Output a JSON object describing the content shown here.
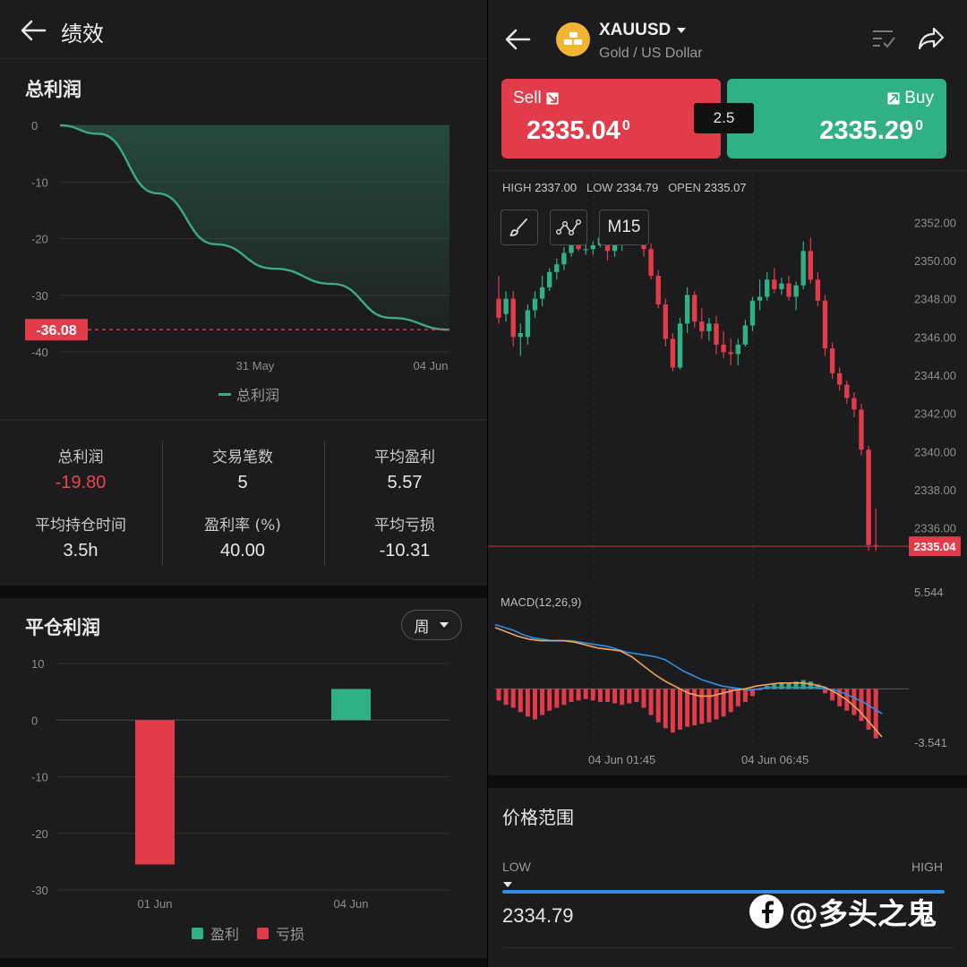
{
  "left": {
    "header": {
      "title": "绩效"
    },
    "total_profit_section": {
      "title": "总利润",
      "current_label": "-36.08",
      "legend": "总利润"
    },
    "stats": [
      {
        "label": "总利润",
        "value": "-19.80",
        "value_color": "#e8454f"
      },
      {
        "label": "交易笔数",
        "value": "5"
      },
      {
        "label": "平均盈利",
        "value": "5.57"
      },
      {
        "label": "平均持仓时间",
        "value": "3.5h"
      },
      {
        "label": "盈利率 (%)",
        "value": "40.00"
      },
      {
        "label": "平均亏损",
        "value": "-10.31"
      }
    ],
    "closed_profit_section": {
      "title": "平仓利润",
      "period_selected": "周",
      "legend_profit": "盈利",
      "legend_loss": "亏损"
    }
  },
  "right": {
    "header": {
      "symbol": "XAUUSD",
      "subtitle": "Gold / US Dollar"
    },
    "sell": {
      "label": "Sell",
      "price_main": "2335.04",
      "price_sup": "0"
    },
    "buy": {
      "label": "Buy",
      "price_main": "2335.29",
      "price_sup": "0"
    },
    "spread": "2.5",
    "ohlc": {
      "high_label": "HIGH",
      "high": "2337.00",
      "low_label": "LOW",
      "low": "2334.79",
      "open_label": "OPEN",
      "open": "2335.07"
    },
    "timeframe": "M15",
    "current_price_label": "2335.04",
    "macd": {
      "label": "MACD(12,26,9)",
      "max": "5.544",
      "min": "-3.541"
    },
    "time_labels": [
      "04 Jun 01:45",
      "04 Jun 06:45"
    ],
    "price_range": {
      "title": "价格范围",
      "low_label": "LOW",
      "high_label": "HIGH",
      "low_value": "2334.79"
    },
    "watermark": "@多头之鬼"
  },
  "colors": {
    "up": "#2fb183",
    "down": "#e23b4a",
    "accent_line": "#3ea983",
    "blue": "#2f8fe6",
    "orange": "#f0a35a"
  },
  "chart_data": [
    {
      "type": "area",
      "title": "总利润",
      "legend": [
        "总利润"
      ],
      "x": [
        "31 May",
        "04 Jun"
      ],
      "yticks": [
        0,
        -10,
        -20,
        -30,
        -40
      ],
      "ylim": [
        -40,
        0
      ],
      "series": [
        {
          "name": "总利润",
          "points": [
            [
              0,
              0
            ],
            [
              0.1,
              -1.5
            ],
            [
              0.25,
              -12
            ],
            [
              0.4,
              -21
            ],
            [
              0.55,
              -25.3
            ],
            [
              0.7,
              -28
            ],
            [
              0.85,
              -34
            ],
            [
              1.0,
              -36.08
            ]
          ]
        }
      ],
      "annotation": {
        "value": -36.08,
        "style": "dashed"
      }
    },
    {
      "type": "bar",
      "title": "平仓利润",
      "categories": [
        "01 Jun",
        "04 Jun"
      ],
      "values": [
        -25.5,
        5.5
      ],
      "yticks": [
        10,
        0,
        -10,
        -20,
        -30
      ],
      "ylim": [
        -30,
        10
      ],
      "legend": [
        "盈利",
        "亏损"
      ]
    },
    {
      "type": "candlestick",
      "title": "XAUUSD M15",
      "yticks": [
        2352,
        2350,
        2348,
        2346,
        2344,
        2342,
        2340,
        2338,
        2336
      ],
      "ylim": [
        2334.2,
        2353
      ],
      "x": [
        "04 Jun 01:45",
        "04 Jun 06:45"
      ],
      "candles": [
        [
          2348.0,
          2349.2,
          2346.7,
          2347.0
        ],
        [
          2347.2,
          2348.4,
          2346.8,
          2348.0
        ],
        [
          2348.0,
          2348.4,
          2345.5,
          2346.0
        ],
        [
          2346.0,
          2346.7,
          2345.0,
          2346.2
        ],
        [
          2346.0,
          2347.7,
          2345.6,
          2347.4
        ],
        [
          2347.4,
          2348.4,
          2347.0,
          2348.0
        ],
        [
          2348.0,
          2349.2,
          2347.6,
          2348.6
        ],
        [
          2348.6,
          2349.6,
          2348.4,
          2349.4
        ],
        [
          2349.4,
          2350.1,
          2349.0,
          2349.8
        ],
        [
          2349.8,
          2350.7,
          2349.5,
          2350.4
        ],
        [
          2350.4,
          2351.4,
          2350.2,
          2351.0
        ],
        [
          2351.0,
          2351.4,
          2350.5,
          2350.6
        ],
        [
          2350.6,
          2351.1,
          2350.3,
          2350.6
        ],
        [
          2350.6,
          2351.0,
          2350.3,
          2350.8
        ],
        [
          2350.8,
          2351.6,
          2350.7,
          2351.2
        ],
        [
          2351.2,
          2351.7,
          2350.0,
          2350.5
        ],
        [
          2350.5,
          2351.0,
          2350.2,
          2350.8
        ],
        [
          2350.8,
          2351.7,
          2350.5,
          2351.4
        ],
        [
          2351.4,
          2352.0,
          2350.9,
          2351.9
        ],
        [
          2351.9,
          2352.3,
          2351.3,
          2352.1
        ],
        [
          2352.1,
          2352.3,
          2350.2,
          2350.6
        ],
        [
          2350.6,
          2350.9,
          2349.0,
          2349.2
        ],
        [
          2349.2,
          2349.5,
          2347.5,
          2347.7
        ],
        [
          2347.7,
          2348.0,
          2345.5,
          2345.9
        ],
        [
          2345.9,
          2346.2,
          2344.2,
          2344.4
        ],
        [
          2344.4,
          2347.0,
          2344.3,
          2346.7
        ],
        [
          2346.7,
          2348.6,
          2346.2,
          2348.2
        ],
        [
          2348.2,
          2348.4,
          2346.5,
          2346.8
        ],
        [
          2346.8,
          2347.5,
          2345.9,
          2346.3
        ],
        [
          2346.3,
          2347.0,
          2345.8,
          2346.7
        ],
        [
          2346.7,
          2347.1,
          2345.1,
          2345.6
        ],
        [
          2345.6,
          2346.3,
          2344.9,
          2345.2
        ],
        [
          2345.2,
          2345.9,
          2344.5,
          2345.1
        ],
        [
          2345.1,
          2345.9,
          2344.5,
          2345.6
        ],
        [
          2345.6,
          2346.9,
          2345.5,
          2346.6
        ],
        [
          2346.6,
          2348.1,
          2346.3,
          2347.9
        ],
        [
          2347.9,
          2349.0,
          2347.4,
          2348.1
        ],
        [
          2348.1,
          2349.4,
          2347.9,
          2349.0
        ],
        [
          2349.0,
          2349.6,
          2348.3,
          2348.5
        ],
        [
          2348.5,
          2349.1,
          2348.2,
          2348.8
        ],
        [
          2348.8,
          2349.2,
          2347.9,
          2348.1
        ],
        [
          2348.1,
          2348.9,
          2347.4,
          2348.7
        ],
        [
          2348.7,
          2351.0,
          2348.5,
          2350.5
        ],
        [
          2350.5,
          2351.2,
          2348.8,
          2349.0
        ],
        [
          2349.0,
          2349.4,
          2347.6,
          2347.9
        ],
        [
          2347.9,
          2348.2,
          2345.0,
          2345.4
        ],
        [
          2345.4,
          2345.7,
          2343.8,
          2344.1
        ],
        [
          2344.1,
          2344.4,
          2343.2,
          2343.5
        ],
        [
          2343.5,
          2343.7,
          2342.5,
          2342.8
        ],
        [
          2342.8,
          2343.1,
          2341.8,
          2342.2
        ],
        [
          2342.2,
          2342.5,
          2339.8,
          2340.1
        ],
        [
          2340.1,
          2340.3,
          2334.8,
          2335.1
        ],
        [
          2335.1,
          2337.0,
          2334.79,
          2335.04
        ]
      ]
    },
    {
      "type": "bar",
      "title": "MACD(12,26,9)",
      "ylim": [
        -3.541,
        5.544
      ],
      "histogram": [
        -0.8,
        -1.1,
        -1.3,
        -1.6,
        -1.9,
        -2.1,
        -1.8,
        -1.5,
        -1.3,
        -1.1,
        -0.9,
        -0.8,
        -0.7,
        -0.8,
        -0.9,
        -0.9,
        -1.0,
        -1.1,
        -1.0,
        -0.9,
        -1.3,
        -1.8,
        -2.3,
        -2.7,
        -3.0,
        -2.8,
        -2.6,
        -2.5,
        -2.4,
        -2.3,
        -2.1,
        -1.9,
        -1.6,
        -1.2,
        -0.9,
        -0.5,
        -0.1,
        0.2,
        0.3,
        0.4,
        0.4,
        0.5,
        0.6,
        0.5,
        0.3,
        -0.3,
        -0.8,
        -1.2,
        -1.5,
        -1.8,
        -2.2,
        -2.8,
        -3.4
      ],
      "macd_line": [
        4.4,
        4.2,
        4.0,
        3.7,
        3.5,
        3.4,
        3.3,
        3.3,
        3.3,
        3.2,
        3.1,
        3.0,
        2.9,
        2.7,
        2.5,
        2.4,
        2.3,
        2.2,
        2.0,
        1.6,
        1.2,
        0.9,
        0.6,
        0.4,
        0.2,
        0.1,
        0.0,
        -0.1,
        0.0,
        0.1,
        0.1,
        0.1,
        0.1,
        0.1,
        0.1,
        0.0,
        -0.1,
        -0.3,
        -0.6,
        -0.9,
        -1.3,
        -1.7
      ],
      "signal_line": [
        4.2,
        3.9,
        3.6,
        3.4,
        3.3,
        3.3,
        3.3,
        3.2,
        3.0,
        2.8,
        2.7,
        2.6,
        2.2,
        1.6,
        1.0,
        0.5,
        0.1,
        -0.3,
        -0.5,
        -0.5,
        -0.3,
        -0.1,
        0.0,
        0.2,
        0.3,
        0.4,
        0.4,
        0.4,
        0.3,
        0.1,
        -0.3,
        -0.8,
        -1.5,
        -2.4,
        -3.3
      ]
    }
  ]
}
